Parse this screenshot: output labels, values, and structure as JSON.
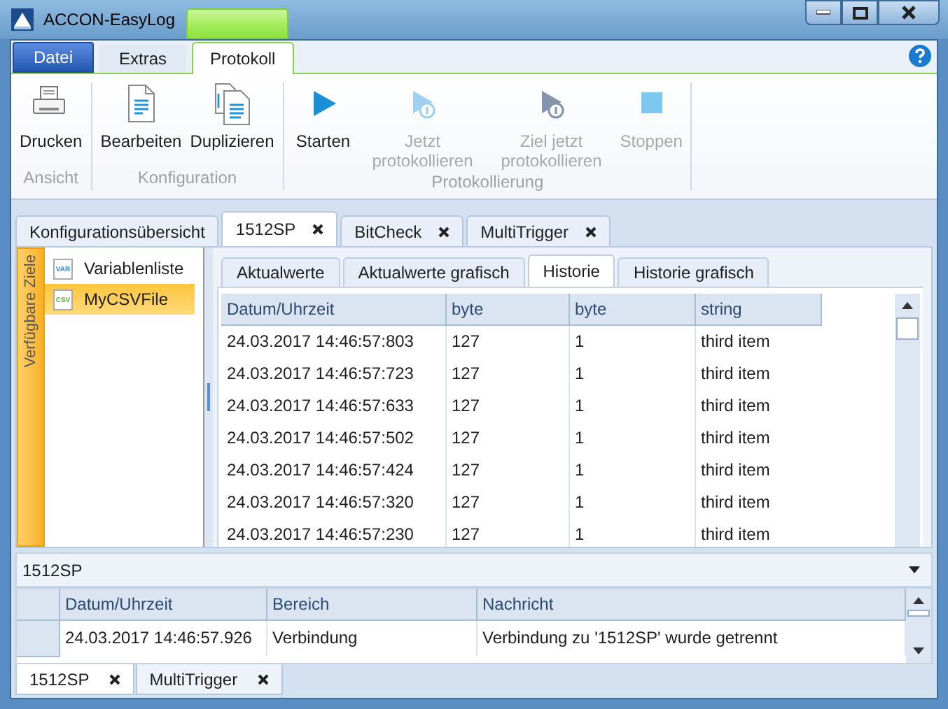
{
  "window": {
    "title": "ACCON-EasyLog"
  },
  "ribbon_tabs": [
    {
      "label": "Datei",
      "kind": "file",
      "selected": false
    },
    {
      "label": "Extras",
      "kind": "tab",
      "selected": false
    },
    {
      "label": "Protokoll",
      "kind": "tab",
      "selected": true
    }
  ],
  "ribbon_groups": [
    {
      "label": "Ansicht",
      "buttons": [
        {
          "label": "Drucken",
          "kind": "printer",
          "disabled": false
        }
      ]
    },
    {
      "label": "Konfiguration",
      "buttons": [
        {
          "label": "Bearbeiten",
          "kind": "document",
          "disabled": false
        },
        {
          "label": "Duplizieren",
          "kind": "documents",
          "disabled": false
        }
      ]
    },
    {
      "label": "Protokollierung",
      "buttons": [
        {
          "label": "Starten",
          "kind": "play",
          "disabled": false
        },
        {
          "label": "Jetzt protokollieren",
          "kind": "playonce",
          "disabled": true
        },
        {
          "label": "Ziel jetzt protokollieren",
          "kind": "playtarget",
          "disabled": true
        },
        {
          "label": "Stoppen",
          "kind": "stop",
          "disabled": true
        }
      ]
    }
  ],
  "document_tabs": [
    {
      "label": "Konfigurationsübersicht",
      "closable": false,
      "selected": false
    },
    {
      "label": "1512SP",
      "closable": true,
      "selected": true
    },
    {
      "label": "BitCheck",
      "closable": true,
      "selected": false
    },
    {
      "label": "MultiTrigger",
      "closable": true,
      "selected": false
    }
  ],
  "sidebar": {
    "title": "Verfügbare Ziele",
    "items": [
      {
        "label": "Variablenliste",
        "badge": "VAR",
        "selected": false
      },
      {
        "label": "MyCSVFile",
        "badge": "CSV",
        "selected": true
      }
    ]
  },
  "view_tabs": [
    {
      "label": "Aktualwerte",
      "selected": false
    },
    {
      "label": "Aktualwerte grafisch",
      "selected": false
    },
    {
      "label": "Historie",
      "selected": true
    },
    {
      "label": "Historie grafisch",
      "selected": false
    }
  ],
  "table": {
    "columns": [
      "Datum/Uhrzeit",
      "byte",
      "byte",
      "string"
    ],
    "rows": [
      [
        "24.03.2017 14:46:57:803",
        "127",
        "1",
        "third item"
      ],
      [
        "24.03.2017 14:46:57:723",
        "127",
        "1",
        "third item"
      ],
      [
        "24.03.2017 14:46:57:633",
        "127",
        "1",
        "third item"
      ],
      [
        "24.03.2017 14:46:57:502",
        "127",
        "1",
        "third item"
      ],
      [
        "24.03.2017 14:46:57:424",
        "127",
        "1",
        "third item"
      ],
      [
        "24.03.2017 14:46:57:320",
        "127",
        "1",
        "third item"
      ],
      [
        "24.03.2017 14:46:57:230",
        "127",
        "1",
        "third item"
      ]
    ]
  },
  "log": {
    "source": "1512SP",
    "columns": [
      "Datum/Uhrzeit",
      "Bereich",
      "Nachricht"
    ],
    "rows": [
      [
        "24.03.2017 14:46:57.926",
        "Verbindung",
        "Verbindung zu '1512SP' wurde getrennt"
      ]
    ]
  },
  "bottom_tabs": [
    {
      "label": "1512SP",
      "selected": true
    },
    {
      "label": "MultiTrigger",
      "selected": false
    }
  ]
}
